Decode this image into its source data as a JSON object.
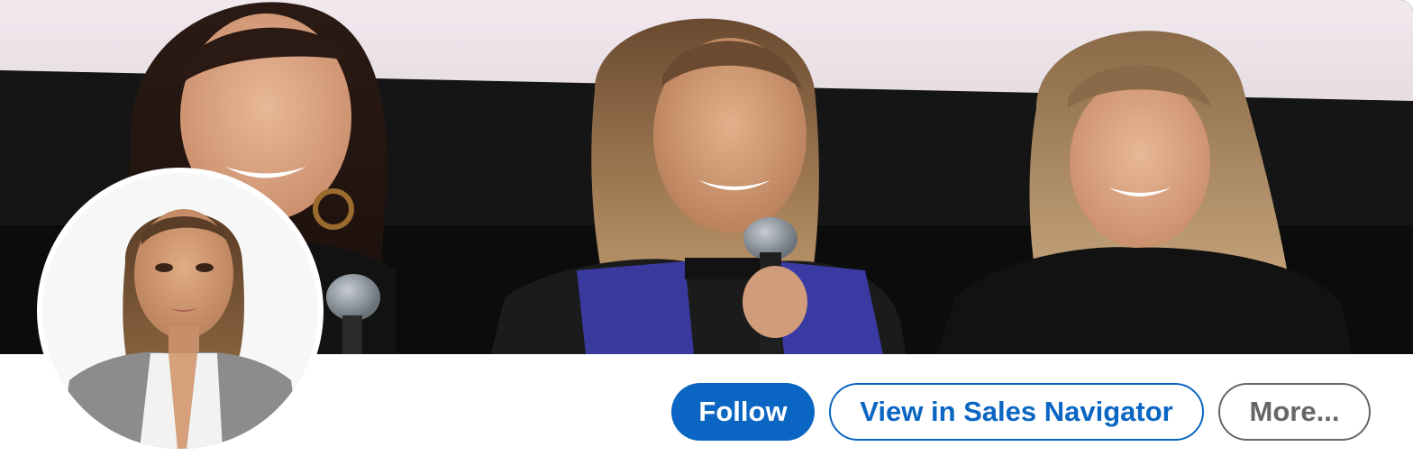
{
  "colors": {
    "accent": "#0a66c2",
    "secondary": "#666666",
    "background": "#ffffff"
  },
  "cover": {
    "image_name": "cover-photo"
  },
  "profile": {
    "image_name": "profile-photo"
  },
  "actions": {
    "follow_label": "Follow",
    "sales_navigator_label": "View in Sales Navigator",
    "more_label": "More..."
  }
}
